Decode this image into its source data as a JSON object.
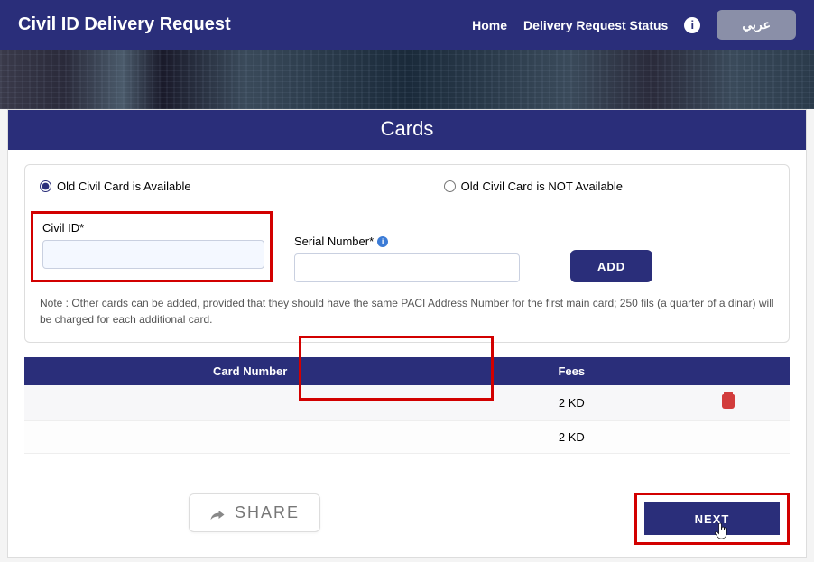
{
  "navbar": {
    "title": "Civil ID Delivery Request",
    "home": "Home",
    "status": "Delivery Request Status",
    "lang": "عربي"
  },
  "page": {
    "cards_header": "Cards",
    "radio_available": "Old Civil Card is Available",
    "radio_not_available": "Old Civil Card is NOT Available",
    "civil_id_label": "Civil ID*",
    "serial_label": "Serial Number*",
    "add_btn": "ADD",
    "note": "Note : Other cards can be added, provided that they should have the same PACI Address Number for the first main card; 250 fils (a quarter of a dinar) will be charged for each additional card.",
    "next_btn": "NEXT",
    "share_btn": "SHARE"
  },
  "table": {
    "col_card": "Card Number",
    "col_fees": "Fees",
    "rows": [
      {
        "card": "",
        "fees": "2 KD",
        "deletable": true
      },
      {
        "card": "",
        "fees": "2 KD",
        "deletable": false
      }
    ]
  }
}
